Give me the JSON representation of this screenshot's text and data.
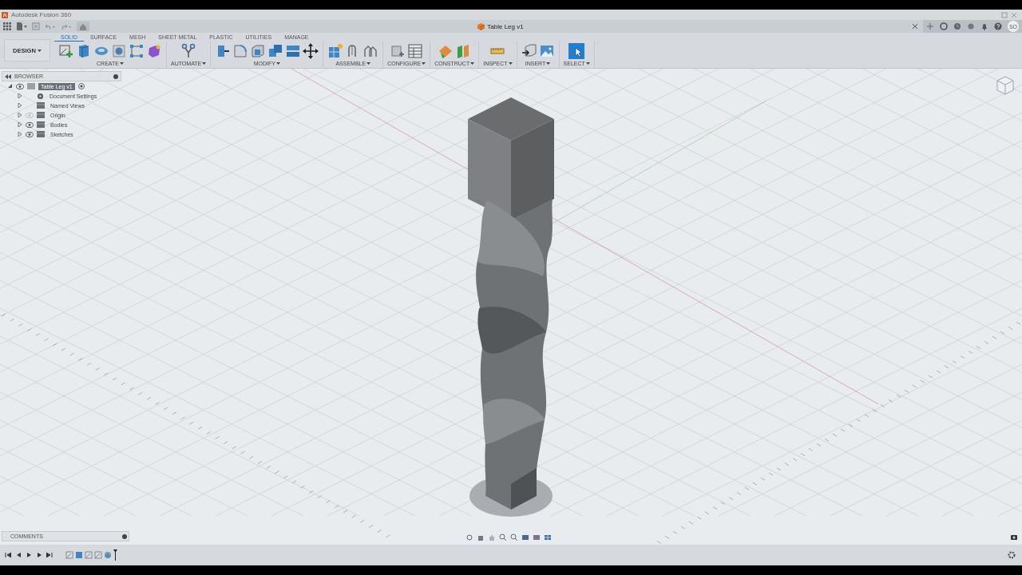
{
  "app_title": "Autodesk Fusion 360",
  "document_tab": {
    "title": "Table Leg v1",
    "selected": true
  },
  "user_initials": "SO",
  "workspace": {
    "label": "DESIGN"
  },
  "toolbar_tabs": [
    {
      "label": "SOLID",
      "selected": true
    },
    {
      "label": "SURFACE",
      "selected": false
    },
    {
      "label": "MESH",
      "selected": false
    },
    {
      "label": "SHEET METAL",
      "selected": false
    },
    {
      "label": "PLASTIC",
      "selected": false
    },
    {
      "label": "UTILITIES",
      "selected": false
    },
    {
      "label": "MANAGE",
      "selected": false
    }
  ],
  "tool_groups": [
    {
      "label": "CREATE",
      "tools": [
        {
          "kind": "sketch"
        },
        {
          "kind": "box"
        },
        {
          "kind": "revolve"
        },
        {
          "kind": "hole"
        },
        {
          "kind": "pattern"
        },
        {
          "kind": "form"
        }
      ]
    },
    {
      "label": "AUTOMATE",
      "tools": [
        {
          "kind": "automate"
        }
      ]
    },
    {
      "label": "MODIFY",
      "tools": [
        {
          "kind": "presspull"
        },
        {
          "kind": "fillet"
        },
        {
          "kind": "shell"
        },
        {
          "kind": "combine"
        },
        {
          "kind": "align"
        },
        {
          "kind": "move"
        }
      ]
    },
    {
      "label": "ASSEMBLE",
      "tools": [
        {
          "kind": "component"
        },
        {
          "kind": "joint"
        },
        {
          "kind": "asjoint"
        }
      ]
    },
    {
      "label": "CONFIGURE",
      "tools": [
        {
          "kind": "config"
        },
        {
          "kind": "table"
        }
      ]
    },
    {
      "label": "CONSTRUCT",
      "tools": [
        {
          "kind": "plane"
        },
        {
          "kind": "midplane"
        }
      ]
    },
    {
      "label": "INSPECT",
      "tools": [
        {
          "kind": "measure"
        }
      ]
    },
    {
      "label": "INSERT",
      "tools": [
        {
          "kind": "insert"
        },
        {
          "kind": "image"
        }
      ]
    },
    {
      "label": "SELECT",
      "tools": [
        {
          "kind": "select"
        }
      ]
    }
  ],
  "browser": {
    "title": "BROWSER",
    "items": [
      {
        "label": "Table Leg v1",
        "kind": "component",
        "selected": true,
        "expanded": true,
        "visible": true,
        "children": [
          {
            "label": "Document Settings",
            "kind": "settings",
            "expanded": false
          },
          {
            "label": "Named Views",
            "kind": "folder",
            "expanded": false
          },
          {
            "label": "Origin",
            "kind": "folder",
            "expanded": false,
            "visible": false
          },
          {
            "label": "Bodies",
            "kind": "folder",
            "expanded": false,
            "visible": true
          },
          {
            "label": "Sketches",
            "kind": "folder",
            "expanded": false,
            "visible": true
          }
        ]
      }
    ]
  },
  "comments": {
    "title": "COMMENTS"
  },
  "timeline": {
    "features": [
      {
        "kind": "sketch"
      },
      {
        "kind": "body"
      },
      {
        "kind": "sketch"
      },
      {
        "kind": "sketch"
      },
      {
        "kind": "sweep"
      }
    ]
  }
}
